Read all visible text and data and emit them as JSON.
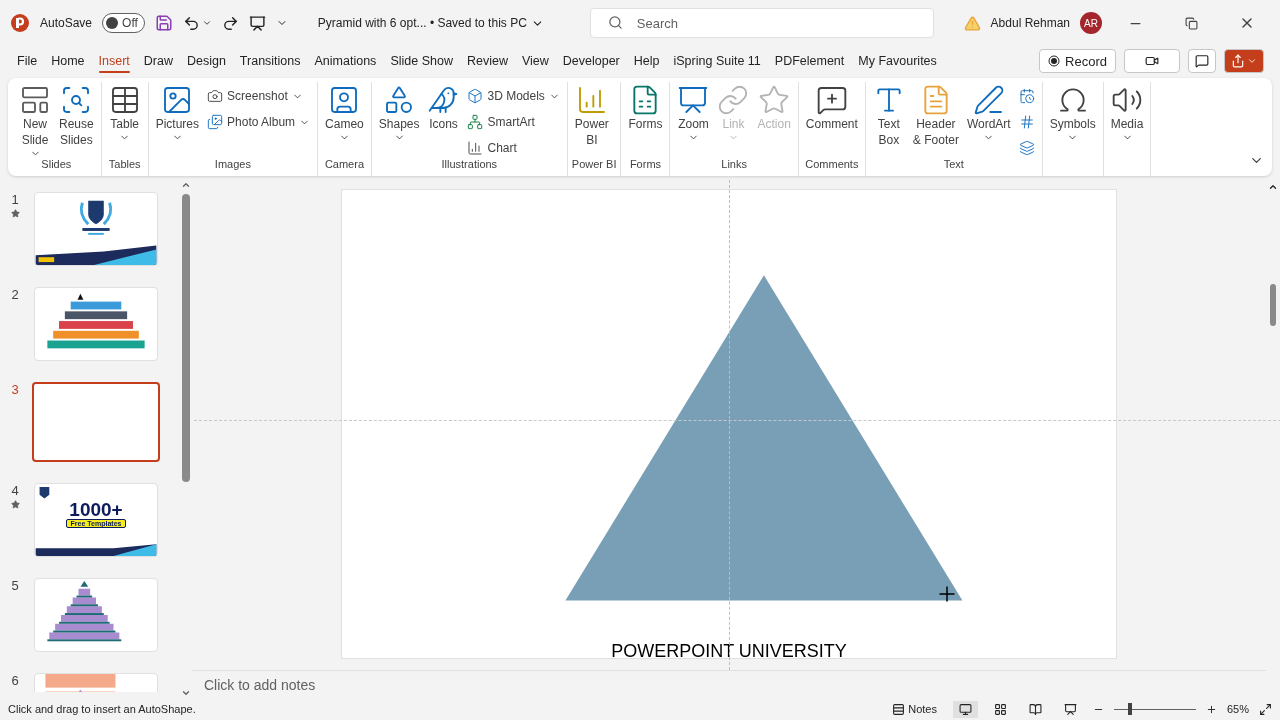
{
  "title_bar": {
    "autosave_label": "AutoSave",
    "autosave_toggle": {
      "label": "Off",
      "on": false
    },
    "document_title": "Pyramid with 6 opt... • Saved to this PC",
    "search": {
      "placeholder": "Search"
    },
    "user_name": "Abdul Rehman",
    "avatar_initials": "AR"
  },
  "tabs": [
    {
      "label": "File",
      "selected": false
    },
    {
      "label": "Home",
      "selected": false
    },
    {
      "label": "Insert",
      "selected": true
    },
    {
      "label": "Draw",
      "selected": false
    },
    {
      "label": "Design",
      "selected": false
    },
    {
      "label": "Transitions",
      "selected": false
    },
    {
      "label": "Animations",
      "selected": false
    },
    {
      "label": "Slide Show",
      "selected": false
    },
    {
      "label": "Review",
      "selected": false
    },
    {
      "label": "View",
      "selected": false
    },
    {
      "label": "Developer",
      "selected": false
    },
    {
      "label": "Help",
      "selected": false
    },
    {
      "label": "iSpring Suite 11",
      "selected": false
    },
    {
      "label": "PDFelement",
      "selected": false
    },
    {
      "label": "My Favourites",
      "selected": false
    }
  ],
  "record_button": "Record",
  "ribbon": {
    "groups": [
      {
        "label": "Slides",
        "items": [
          {
            "kind": "large",
            "lines": [
              "New",
              "Slide"
            ],
            "dropdown": true,
            "disabled": false
          },
          {
            "kind": "large",
            "lines": [
              "Reuse",
              "Slides"
            ],
            "dropdown": false,
            "disabled": false
          }
        ]
      },
      {
        "label": "Tables",
        "items": [
          {
            "kind": "large",
            "lines": [
              "Table"
            ],
            "dropdown": true,
            "disabled": false
          }
        ]
      },
      {
        "label": "Images",
        "items": [
          {
            "kind": "large",
            "lines": [
              "Pictures"
            ],
            "dropdown": true,
            "disabled": false
          },
          {
            "kind": "stack",
            "items": [
              {
                "label": "Screenshot",
                "dropdown": true
              },
              {
                "label": "Photo Album",
                "dropdown": true
              }
            ]
          }
        ]
      },
      {
        "label": "Camera",
        "items": [
          {
            "kind": "large",
            "lines": [
              "Cameo"
            ],
            "dropdown": true,
            "disabled": false
          }
        ]
      },
      {
        "label": "Illustrations",
        "items": [
          {
            "kind": "large",
            "lines": [
              "Shapes"
            ],
            "dropdown": true,
            "disabled": false
          },
          {
            "kind": "large",
            "lines": [
              "Icons"
            ],
            "dropdown": false,
            "disabled": false
          },
          {
            "kind": "stack",
            "items": [
              {
                "label": "3D Models",
                "dropdown": true
              },
              {
                "label": "SmartArt",
                "dropdown": false
              },
              {
                "label": "Chart",
                "dropdown": false
              }
            ]
          }
        ]
      },
      {
        "label": "Power BI",
        "items": [
          {
            "kind": "large",
            "lines": [
              "Power",
              "BI"
            ],
            "dropdown": false,
            "disabled": false
          }
        ]
      },
      {
        "label": "Forms",
        "items": [
          {
            "kind": "large",
            "lines": [
              "Forms"
            ],
            "dropdown": false,
            "disabled": false
          }
        ]
      },
      {
        "label": "Links",
        "items": [
          {
            "kind": "large",
            "lines": [
              "Zoom"
            ],
            "dropdown": true,
            "disabled": false
          },
          {
            "kind": "large",
            "lines": [
              "Link"
            ],
            "dropdown": true,
            "disabled": true
          },
          {
            "kind": "large",
            "lines": [
              "Action"
            ],
            "dropdown": false,
            "disabled": true
          }
        ]
      },
      {
        "label": "Comments",
        "items": [
          {
            "kind": "large",
            "lines": [
              "Comment"
            ],
            "dropdown": false,
            "disabled": false
          }
        ]
      },
      {
        "label": "Text",
        "items": [
          {
            "kind": "large",
            "lines": [
              "Text",
              "Box"
            ],
            "dropdown": false,
            "disabled": false
          },
          {
            "kind": "large",
            "lines": [
              "Header",
              "& Footer"
            ],
            "dropdown": false,
            "disabled": false
          },
          {
            "kind": "large",
            "lines": [
              "WordArt"
            ],
            "dropdown": true,
            "disabled": false
          },
          {
            "kind": "stack",
            "items": [
              {
                "dropdown": false
              },
              {
                "dropdown": false
              },
              {
                "dropdown": false
              }
            ]
          }
        ]
      },
      {
        "items": [
          {
            "kind": "large",
            "lines": [
              "Symbols"
            ],
            "dropdown": true,
            "disabled": false
          }
        ]
      },
      {
        "items": [
          {
            "kind": "large",
            "lines": [
              "Media"
            ],
            "dropdown": true,
            "disabled": false
          }
        ]
      }
    ]
  },
  "slides": [
    {
      "number": "1",
      "starred": true,
      "selected": false,
      "kind": "title"
    },
    {
      "number": "2",
      "starred": false,
      "selected": false,
      "kind": "steps"
    },
    {
      "number": "3",
      "starred": false,
      "selected": true,
      "kind": "blank"
    },
    {
      "number": "4",
      "starred": true,
      "selected": false,
      "kind": "promo",
      "headline": "1000+",
      "badge": "Free Templates"
    },
    {
      "number": "5",
      "starred": false,
      "selected": false,
      "kind": "pyramid"
    },
    {
      "number": "6",
      "starred": false,
      "selected": false,
      "kind": "partial"
    }
  ],
  "slide": {
    "caption": "POWERPOINT UNIVERSITY"
  },
  "notes_placeholder": "Click to add notes",
  "status_bar": {
    "message": "Click and drag to insert an AutoShape.",
    "notes_button": "Notes",
    "zoom": {
      "level": 0.2,
      "reading": "65%"
    }
  }
}
